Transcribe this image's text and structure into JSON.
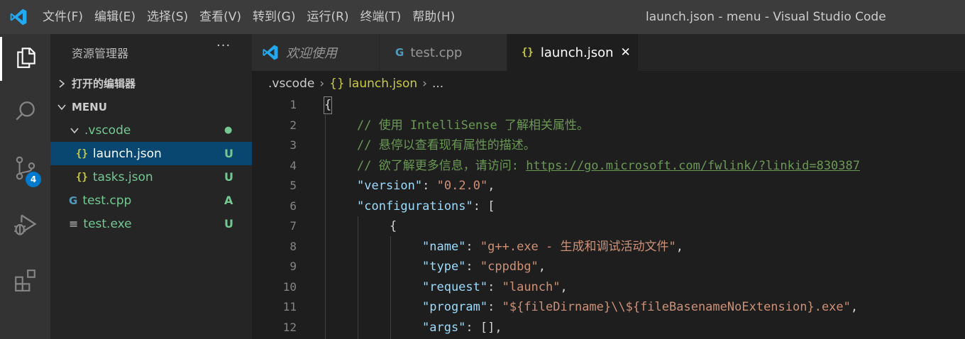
{
  "titlebar": {
    "menus": [
      "文件(F)",
      "编辑(E)",
      "选择(S)",
      "查看(V)",
      "转到(G)",
      "运行(R)",
      "终端(T)",
      "帮助(H)"
    ],
    "window_title": "launch.json - menu - Visual Studio Code"
  },
  "activitybar": {
    "items": [
      "files-icon",
      "search-icon",
      "source-control-icon",
      "run-debug-icon",
      "extensions-icon"
    ],
    "scm_badge": "4"
  },
  "sidebar": {
    "header": "资源管理器",
    "more": "···",
    "open_editors": "打开的编辑器",
    "folder": "MENU",
    "tree": [
      {
        "label": ".vscode",
        "icon": "folder",
        "status": "●",
        "status_color": "#73c991",
        "label_color": "#73c991"
      },
      {
        "label": "launch.json",
        "icon": "{}",
        "status": "U",
        "status_color": "#73c991",
        "label_color": "#ffffff",
        "selected": true
      },
      {
        "label": "tasks.json",
        "icon": "{}",
        "status": "U",
        "status_color": "#73c991",
        "label_color": "#73c991"
      },
      {
        "label": "test.cpp",
        "icon": "G",
        "status": "A",
        "status_color": "#73c991",
        "label_color": "#73c991"
      },
      {
        "label": "test.exe",
        "icon": "≡",
        "status": "U",
        "status_color": "#73c991",
        "label_color": "#73c991"
      }
    ]
  },
  "tabs": [
    {
      "label": "欢迎使用",
      "icon": "vscode-logo-icon"
    },
    {
      "label": "test.cpp",
      "icon": "G"
    },
    {
      "label": "launch.json",
      "icon": "{}",
      "active": true,
      "close": "✕"
    }
  ],
  "breadcrumb": [
    ".vscode",
    "{} launch.json",
    "..."
  ],
  "editor": {
    "line_numbers": [
      "1",
      "2",
      "3",
      "4",
      "5",
      "6",
      "7",
      "8",
      "9",
      "10",
      "11",
      "12"
    ],
    "lines": [
      [
        [
          "{",
          "punct"
        ]
      ],
      [
        [
          "// 使用 IntelliSense 了解相关属性。",
          "comment"
        ]
      ],
      [
        [
          "// 悬停以查看现有属性的描述。",
          "comment"
        ]
      ],
      [
        [
          "// 欲了解更多信息，请访问: ",
          "comment"
        ],
        [
          "https://go.microsoft.com/fwlink/?linkid=830387",
          "link"
        ]
      ],
      [
        [
          "\"version\"",
          "key"
        ],
        [
          ": ",
          "punct"
        ],
        [
          "\"0.2.0\"",
          "str"
        ],
        [
          ",",
          "punct"
        ]
      ],
      [
        [
          "\"configurations\"",
          "key"
        ],
        [
          ": [",
          "punct"
        ]
      ],
      [
        [
          "{",
          "punct"
        ]
      ],
      [
        [
          "\"name\"",
          "key"
        ],
        [
          ": ",
          "punct"
        ],
        [
          "\"g++.exe - 生成和调试活动文件\"",
          "str"
        ],
        [
          ",",
          "punct"
        ]
      ],
      [
        [
          "\"type\"",
          "key"
        ],
        [
          ": ",
          "punct"
        ],
        [
          "\"cppdbg\"",
          "str"
        ],
        [
          ",",
          "punct"
        ]
      ],
      [
        [
          "\"request\"",
          "key"
        ],
        [
          ": ",
          "punct"
        ],
        [
          "\"launch\"",
          "str"
        ],
        [
          ",",
          "punct"
        ]
      ],
      [
        [
          "\"program\"",
          "key"
        ],
        [
          ": ",
          "punct"
        ],
        [
          "\"${fileDirname}\\\\${fileBasenameNoExtension}.exe\"",
          "str"
        ],
        [
          ",",
          "punct"
        ]
      ],
      [
        [
          "\"args\"",
          "key"
        ],
        [
          ": [],",
          "punct"
        ]
      ]
    ]
  }
}
